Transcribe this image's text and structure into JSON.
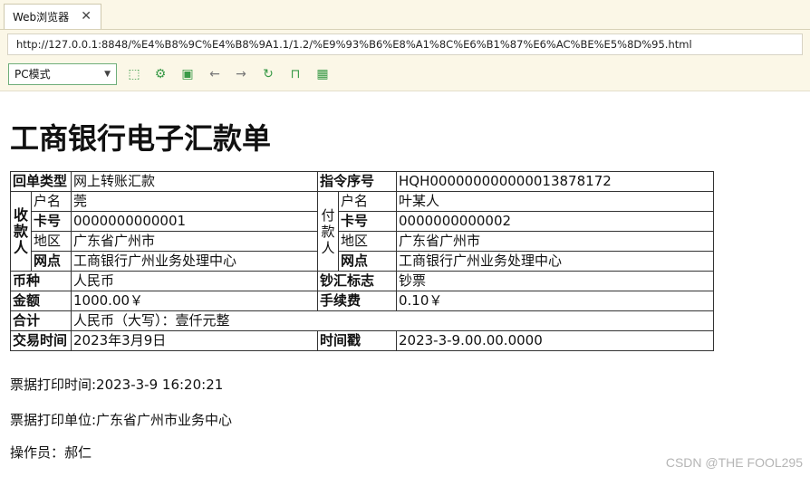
{
  "browser": {
    "tab_title": "Web浏览器",
    "url": "http://127.0.0.1:8848/%E4%B8%9C%E4%B8%9A1.1/1.2/%E9%93%B6%E8%A1%8C%E6%B1%87%E6%AC%BE%E5%8D%95.html",
    "mode_select": "PC模式"
  },
  "page": {
    "title": "工商银行电子汇款单",
    "rows": {
      "type_label": "回单类型",
      "type_value": "网上转账汇款",
      "order_label": "指令序号",
      "order_value": "HQH000000000000013878172",
      "payee_label": "收款人",
      "payer_label": "付款人",
      "name_label": "户名",
      "card_label": "卡号",
      "region_label": "地区",
      "branch_label": "网点",
      "payee_name": "莞",
      "payee_card": "0000000000001",
      "payee_region": "广东省广州市",
      "payee_branch": "工商银行广州业务处理中心",
      "payer_name": "叶某人",
      "payer_card": "0000000000002",
      "payer_region": "广东省广州市",
      "payer_branch": "工商银行广州业务处理中心",
      "currency_label": "币种",
      "currency_value": "人民币",
      "cash_label": "钞汇标志",
      "cash_value": "钞票",
      "amount_label": "金额",
      "amount_value": "1000.00￥",
      "fee_label": "手续费",
      "fee_value": "0.10￥",
      "total_label": "合计",
      "total_value": "人民币（大写）：壹仟元整",
      "time_label": "交易时间",
      "time_value": "2023年3月9日",
      "stamp_label": "时间戳",
      "stamp_value": "2023-3-9.00.00.0000"
    },
    "print_time": "票据打印时间:2023-3-9 16:20:21",
    "print_unit": "票据打印单位:广东省广州市业务中心",
    "operator": "操作员：郝仁"
  },
  "watermark": "CSDN @THE FOOL295"
}
